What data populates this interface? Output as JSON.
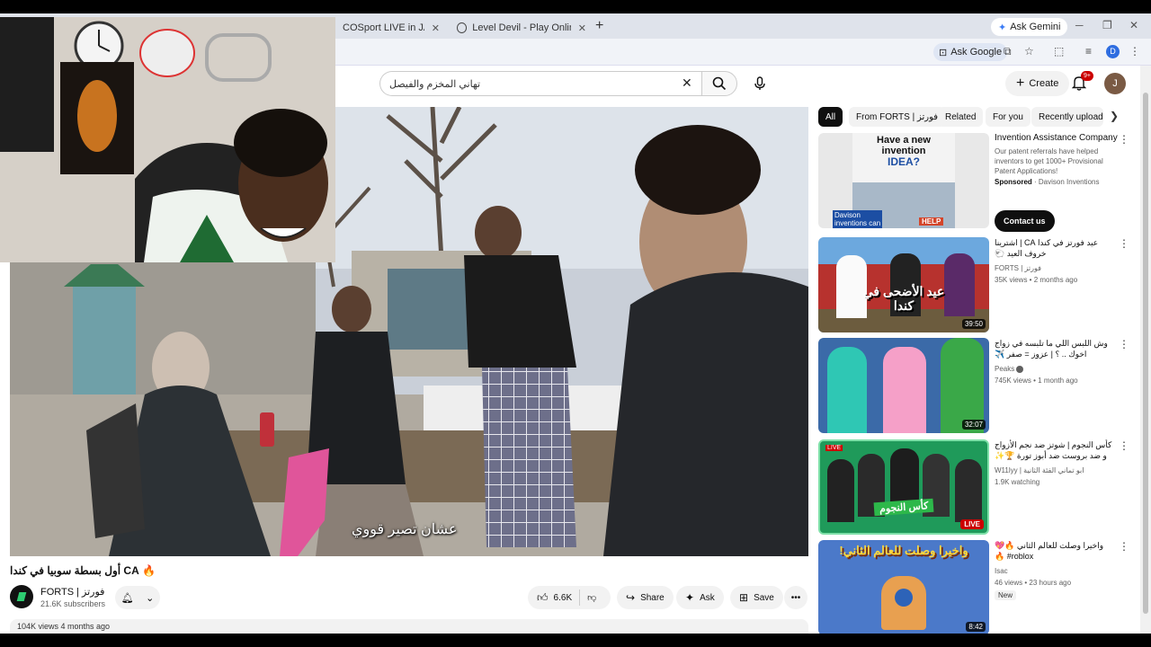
{
  "browser": {
    "tabs": [
      {
        "label": "COSport LIVE in JACO - JACO"
      },
      {
        "label": "Level Devil - Play Online for Fre"
      }
    ],
    "gemini_label": "Ask Gemini",
    "ask_google_label": "Ask Google",
    "profile_letter": "D"
  },
  "header": {
    "search_query": "تهاني المخزم والفيصل",
    "create_label": "Create",
    "notif_badge": "9+",
    "avatar_letter": "J"
  },
  "player": {
    "subtitle": "عشان تصير قووي"
  },
  "video": {
    "title": "🔥 CA أول بسطة سوبيا في كندا",
    "channel_name": "FORTS | فورتز",
    "subscribers": "21.6K subscribers",
    "likes": "6.6K",
    "share_label": "Share",
    "ask_label": "Ask",
    "save_label": "Save",
    "views_line": "104K views  4 months ago"
  },
  "chips": [
    "All",
    "From FORTS | فورتز",
    "Related",
    "For you",
    "Recently uploaded"
  ],
  "ad": {
    "thumb_text1": "Have a new",
    "thumb_text2": "invention",
    "thumb_text3": "IDEA?",
    "thumb_text4": "Davison",
    "thumb_text5": "inventions can",
    "thumb_help": "HELP",
    "title": "Invention Assistance Company",
    "desc": "Our patent referrals have helped inventors to get 1000+ Provisional Patent Applications!",
    "sponsored": "Sponsored",
    "sponsor_name": "Davison Inventions",
    "cta": "Contact us"
  },
  "recommendations": [
    {
      "title": "عيد فورتز في كندا CA | اشترينا خروف العيد 🐑",
      "channel": "FORTS | فورتز",
      "meta": "35K views • 2 months ago",
      "duration": "39:50",
      "thumb_text": "عيد الأضحى في كندا"
    },
    {
      "title": "وش اللبس اللي ما تلبسه في زواج اخوك .. ؟ | عزوز = صفر ✈️",
      "channel": "Peaks",
      "meta": "745K views • 1 month ago",
      "duration": "32:07"
    },
    {
      "title": "كأس النجوم | شوتز ضد نجم الأزواج و ضد بروست ضد أبوز تورة 🏆✨",
      "channel": "W11lyy | ابو تماني الفئة الثانية",
      "meta": "1.9K watching",
      "live": "LIVE",
      "live_tag": "LIVE",
      "thumb_text": "كأس النجوم"
    },
    {
      "title": "واخيرا وصلت للعالم الثاني 🔥💖 roblox# 🔥",
      "channel": "Isac",
      "meta": "46 views • 23 hours ago",
      "badge": "New",
      "duration": "8:42",
      "thumb_text": "واخيرا وصلت للعالم الثاني!"
    }
  ]
}
